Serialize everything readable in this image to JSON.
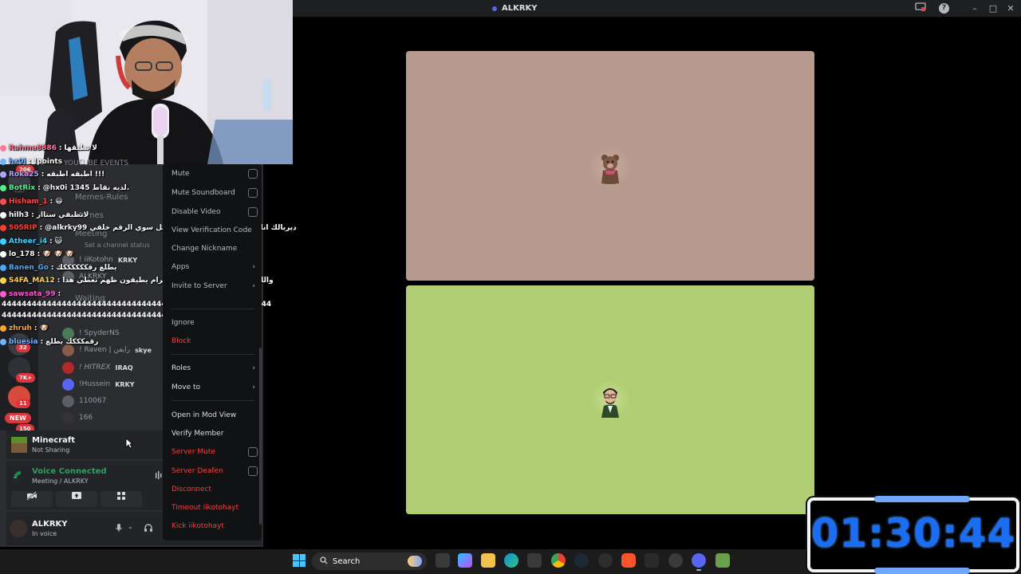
{
  "window": {
    "title": "ALKRKY"
  },
  "call": {
    "tiles": [
      {
        "avatar": "bear-avatar-icon",
        "bg": "#b79a8e"
      },
      {
        "avatar": "man-avatar-icon",
        "bg": "#b0cd73"
      }
    ]
  },
  "chat": {
    "lines": [
      {
        "user": "Rahma8886",
        "sep": ":",
        "msg": "لا تطبقها",
        "color": "#ff7a9c"
      },
      {
        "user": "hx0i",
        "sep": ":",
        "msg": "!points",
        "color": "#6fb3ff"
      },
      {
        "user": "Roka25",
        "sep": ":",
        "msg": "اطبقه اطبقه !!!",
        "color": "#b0a4ff"
      },
      {
        "user": "BotRix",
        "sep": ":",
        "msg": "@hx0i 1345 لديه نقاط.",
        "color": "#4ef08a"
      },
      {
        "user": "Hisham_1",
        "sep": ":",
        "msg": "😀",
        "color": "#ff4a4a"
      },
      {
        "user": "hilh3",
        "sep": ":",
        "msg": "لاتطبقي ستاار",
        "color": "#ffffff"
      },
      {
        "user": "505RIP",
        "sep": ":",
        "msg": "@alkrky99 ديربالك انا واحد يصدقك يطلع الرقم لكل سوي الرقم خلفي",
        "color": "#ff3b30"
      },
      {
        "user": "Atheer_i4",
        "sep": ":",
        "msg": "😺",
        "color": "#3bd3ff"
      },
      {
        "user": "lo_178",
        "sep": ":",
        "msg": "🐶 🐶 🐶",
        "color": "#ffffff"
      },
      {
        "user": "Banen_Go",
        "sep": ":",
        "msg": "يطلع رقككككككك",
        "color": "#4aa9ff"
      },
      {
        "user": "S4FA_MA12",
        "sep": ":",
        "msg": "والله مسوين قد استكرات بل تكرام يطيقون ظهم تعطي هدا",
        "color": "#ffd54a"
      },
      {
        "user": "sawsata_99",
        "sep": ":",
        "msg": "",
        "color": "#ff5ad2"
      },
      {
        "user": "zhruh",
        "sep": ":",
        "msg": "🐶",
        "color": "#ffa726"
      },
      {
        "user": "bluesia",
        "sep": ":",
        "msg": "رقمكككك يطلع",
        "color": "#6fb3ff"
      }
    ],
    "spam1": "4444444444444444444444444444444444444444444444444444444444444444",
    "spam2": "4444444444444444444444444444444444444444"
  },
  "sidebar": {
    "channels": [
      "YOUTUBE EVENTS",
      "Memes-Rules",
      "Memes",
      "Meeting",
      "Set a channel status",
      "Waiting"
    ],
    "members": [
      {
        "name": "! iiKotohn",
        "tag": "KRKY"
      },
      {
        "name": "ALKRKY",
        "tag": ""
      },
      {
        "name": "! SpyderNS",
        "tag": ""
      },
      {
        "name": "! Raven | رايفن",
        "tag": "skye"
      },
      {
        "name": "! HITREX",
        "tag": "IRAQ"
      },
      {
        "name": "!Hussein",
        "tag": "KRKY"
      },
      {
        "name": "110067",
        "tag": ""
      },
      {
        "name": "166",
        "tag": ""
      }
    ],
    "badges": [
      "206",
      "32",
      "7K+",
      "11",
      "NEW",
      "150"
    ]
  },
  "activity": {
    "title": "Minecraft",
    "subtitle": "Not Sharing"
  },
  "voice": {
    "status": "Voice Connected",
    "channel": "Meeting / ALKRKY"
  },
  "user": {
    "name": "ALKRKY",
    "status": "In voice"
  },
  "menu": {
    "items": [
      {
        "label": "Mute",
        "kind": "check"
      },
      {
        "label": "Mute Soundboard",
        "kind": "check"
      },
      {
        "label": "Disable Video",
        "kind": "check"
      },
      {
        "label": "View Verification Code",
        "kind": "plain"
      },
      {
        "label": "Change Nickname",
        "kind": "plain"
      },
      {
        "label": "Apps",
        "kind": "sub"
      },
      {
        "label": "Invite to Server",
        "kind": "sub"
      },
      {
        "label": "Ignore",
        "kind": "plain"
      },
      {
        "label": "Block",
        "kind": "danger"
      },
      {
        "label": "Roles",
        "kind": "sub-bright"
      },
      {
        "label": "Move to",
        "kind": "sub-bright"
      },
      {
        "label": "Open in Mod View",
        "kind": "bright"
      },
      {
        "label": "Verify Member",
        "kind": "bright"
      },
      {
        "label": "Server Mute",
        "kind": "danger-check"
      },
      {
        "label": "Server Deafen",
        "kind": "danger-check"
      },
      {
        "label": "Disconnect",
        "kind": "danger"
      },
      {
        "label": "Timeout iikotohayt",
        "kind": "danger"
      },
      {
        "label": "Kick iikotohayt",
        "kind": "danger"
      }
    ]
  },
  "taskbar": {
    "search_label": "Search"
  },
  "timer": {
    "value": "01:30:44",
    "color": "#1b6ef3"
  }
}
